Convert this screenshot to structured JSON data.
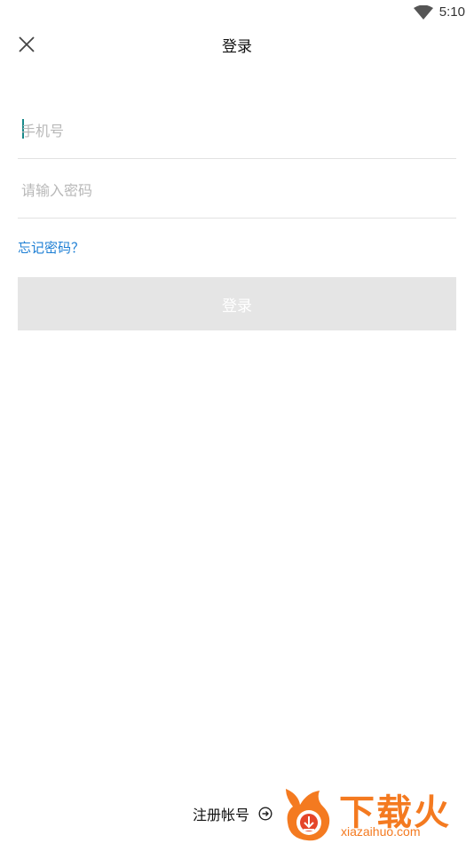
{
  "status_bar": {
    "time": "5:10",
    "wifi_icon": "wifi-icon"
  },
  "header": {
    "title": "登录",
    "close_icon": "close-icon"
  },
  "form": {
    "phone": {
      "placeholder": "手机号",
      "value": ""
    },
    "password": {
      "placeholder": "请输入密码",
      "value": ""
    },
    "forgot_label": "忘记密码？",
    "login_label": "登录"
  },
  "footer": {
    "register_label": "注册帐号",
    "register_icon": "arrow-right-circle-icon"
  },
  "watermark": {
    "text": "下载火",
    "subtext": "xiazaihuo.com"
  },
  "colors": {
    "link": "#1e7fd4",
    "button_disabled": "#e5e5e5",
    "caret": "#1a8a8a",
    "watermark": "#f47a20"
  }
}
